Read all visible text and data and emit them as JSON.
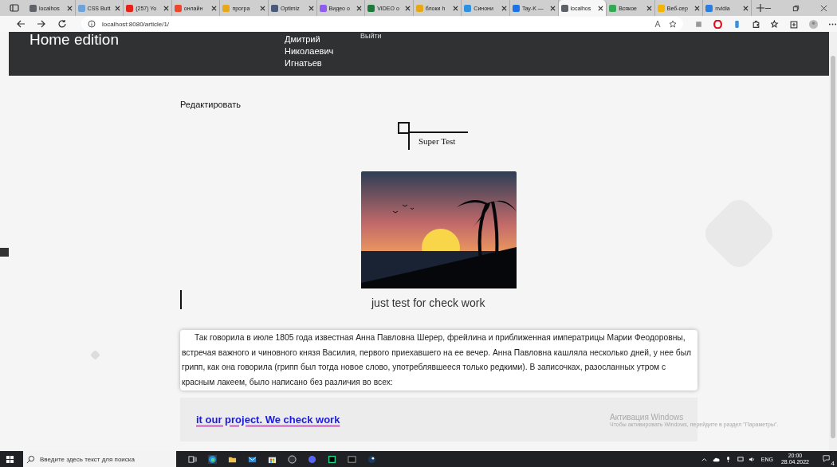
{
  "browser": {
    "tabs": [
      {
        "label": "localhos",
        "selected": false,
        "color": "#5f6368"
      },
      {
        "label": "CSS Butt",
        "selected": false,
        "color": "#6fa3d8"
      },
      {
        "label": "(257) Yo",
        "selected": false,
        "color": "#e62117"
      },
      {
        "label": "онлайн",
        "selected": false,
        "color": "#f0442c"
      },
      {
        "label": "програ",
        "selected": false,
        "color": "#e6a817"
      },
      {
        "label": "Optimiz",
        "selected": false,
        "color": "#4a5a78"
      },
      {
        "label": "Видео о",
        "selected": false,
        "color": "#8e5cf0"
      },
      {
        "label": "VIDEO о",
        "selected": false,
        "color": "#1d7a3a"
      },
      {
        "label": "блоки h",
        "selected": false,
        "color": "#e6a817"
      },
      {
        "label": "Синони",
        "selected": false,
        "color": "#2f8fe0"
      },
      {
        "label": "Tay-K —",
        "selected": false,
        "color": "#1a73e8"
      },
      {
        "label": "localhos",
        "selected": true,
        "color": "#5f6368"
      },
      {
        "label": "Всякое",
        "selected": false,
        "color": "#34a853"
      },
      {
        "label": "Веб-сер",
        "selected": false,
        "color": "#f4b400"
      },
      {
        "label": "nvidia",
        "selected": false,
        "color": "#2a7de1"
      }
    ],
    "address": "localhost:8080/article/1/"
  },
  "header": {
    "brand": "Home edition",
    "user_name": "Дмитрий Николаевич Игнатьев",
    "logout": "Выйти"
  },
  "article": {
    "edit_link": "Редактировать",
    "title": "Super Test",
    "caption": "just test for check work",
    "body": "Так говорила в июле 1805 года известная Анна Павловна Шерер, фрейлина и приближенная императрицы Марии Феодоровны, встречая важного и чиновного князя Василия, первого приехавшего на ее вечер. Анна Павловна кашляла несколько дней, у нее был грипп, как она говорила (грипп был тогда новое слово, употреблявшееся только редкими). В записочках, разосланных утром с красным лакеем, было написано без различия во всех:",
    "footer_link": "it our project. We check work"
  },
  "activation": {
    "title": "Активация Windows",
    "hint": "Чтобы активировать Windows, перейдите в раздел \"Параметры\"."
  },
  "taskbar": {
    "search_placeholder": "Введите здесь текст для поиска",
    "language": "ENG",
    "time": "20:00",
    "date": "28.04.2022",
    "notifications": "4"
  }
}
